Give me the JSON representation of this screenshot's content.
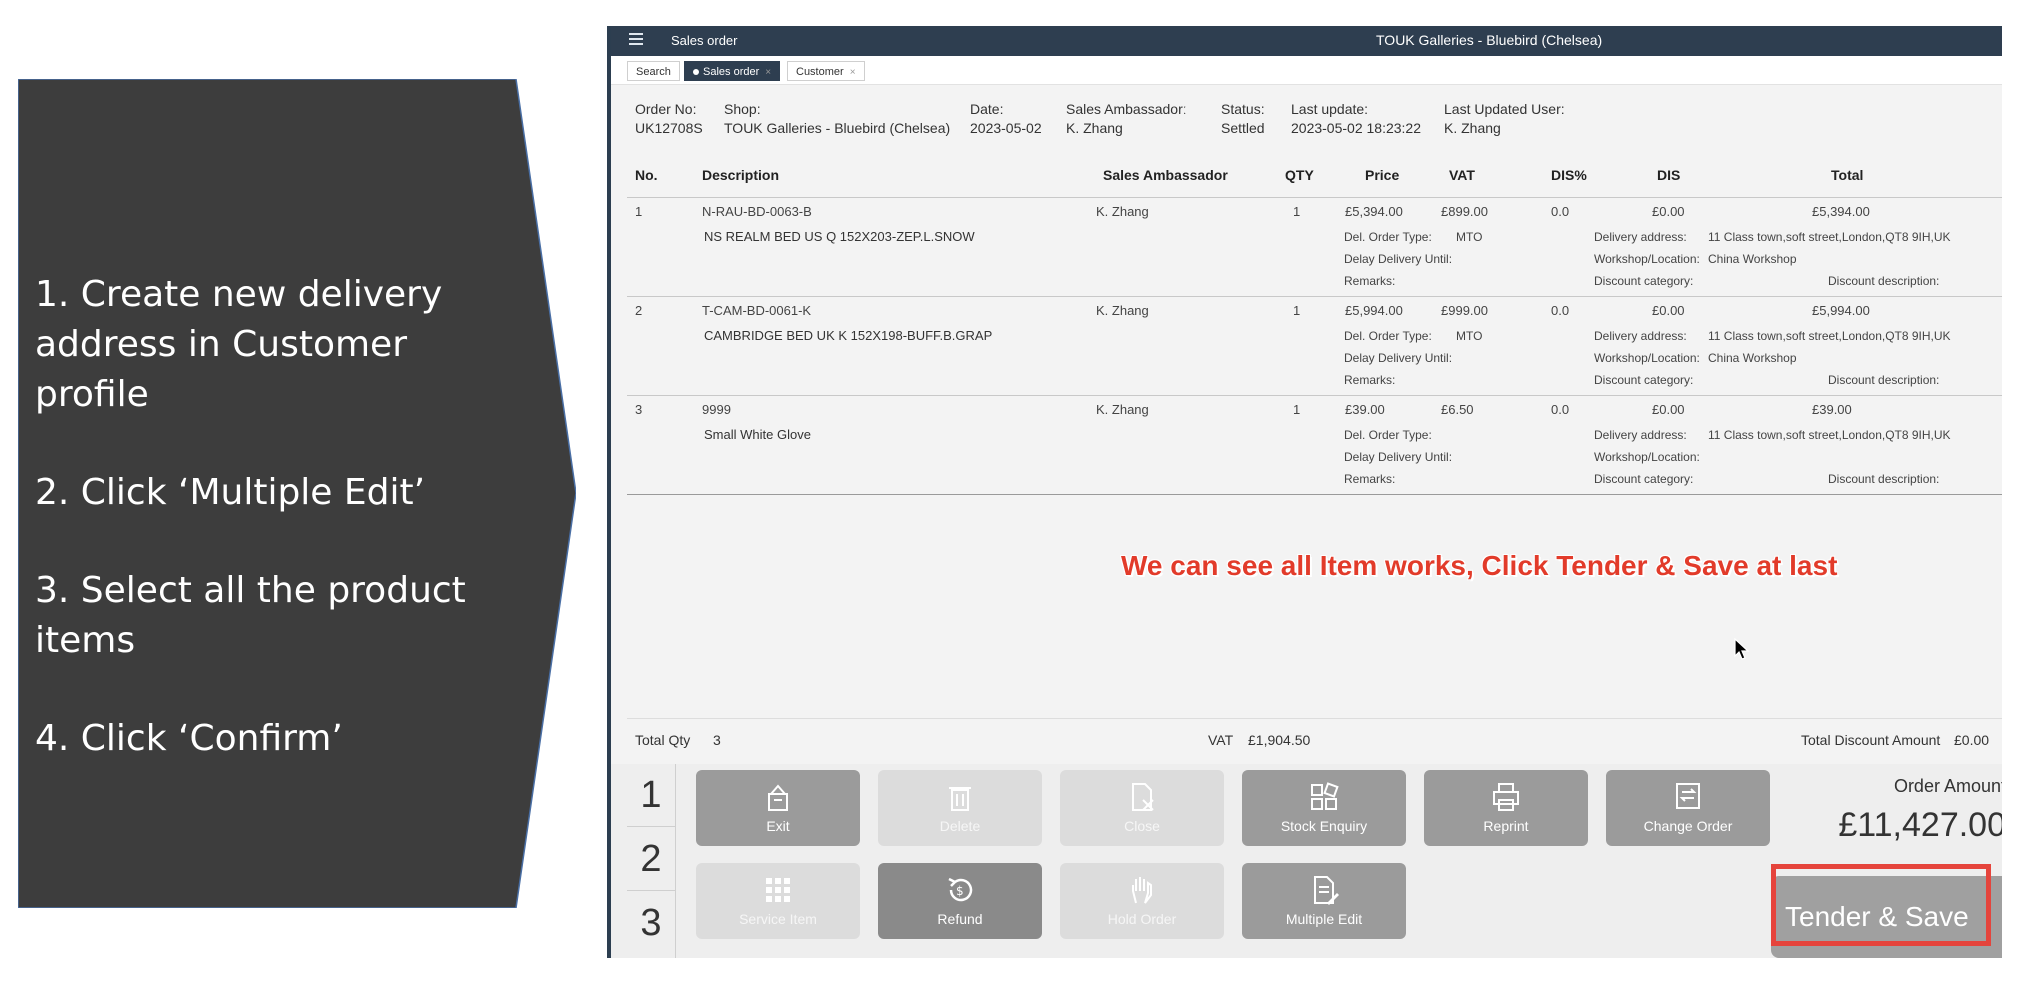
{
  "instructions": [
    "1. Create new delivery address in Customer profile",
    "2. Click ‘Multiple Edit’",
    "3. Select all the product items",
    "4. Click ‘Confirm’"
  ],
  "window": {
    "title": "Sales order",
    "shop_title": "TOUK Galleries - Bluebird (Chelsea)"
  },
  "tabs": [
    "Search",
    "Sales order",
    "Customer"
  ],
  "order_header": {
    "order_no_label": "Order No:",
    "order_no": "UK12708S",
    "shop_label": "Shop:",
    "shop": "TOUK Galleries - Bluebird (Chelsea)",
    "date_label": "Date:",
    "date": "2023-05-02",
    "ambassador_label": "Sales Ambassadorː",
    "ambassador": "K. Zhang",
    "status_label": "Status:",
    "status": "Settled",
    "last_update_label": "Last update:",
    "last_update": "2023-05-02 18:23:22",
    "last_user_label": "Last Updated User:",
    "last_user": "K. Zhang"
  },
  "columns": [
    "No.",
    "Description",
    "Sales Ambassador",
    "QTY",
    "Price",
    "VAT",
    "DIS%",
    "DIS",
    "Total"
  ],
  "detail_labels": {
    "del_type": "Del. Order Type:",
    "delay": "Delay Delivery Until:",
    "remarks": "Remarks:",
    "address": "Delivery address:",
    "workshop": "Workshop/Location:",
    "disc_cat": "Discount category:",
    "disc_desc": "Discount description:"
  },
  "items": [
    {
      "no": "1",
      "code": "N-RAU-BD-0063-B",
      "name": "NS REALM BED US Q 152X203-ZEP.L.SNOW",
      "ambassador": "K. Zhang",
      "qty": "1",
      "price": "£5,394.00",
      "vat": "£899.00",
      "dis_pct": "0.0",
      "dis": "£0.00",
      "total": "£5,394.00",
      "del_type": "MTO",
      "address": "11 Class town,soft street,London,QT8 9IH,UK",
      "workshop": "China Workshop"
    },
    {
      "no": "2",
      "code": "T-CAM-BD-0061-K",
      "name": "CAMBRIDGE BED UK K 152X198-BUFF.B.GRAP",
      "ambassador": "K. Zhang",
      "qty": "1",
      "price": "£5,994.00",
      "vat": "£999.00",
      "dis_pct": "0.0",
      "dis": "£0.00",
      "total": "£5,994.00",
      "del_type": "MTO",
      "address": "11 Class town,soft street,London,QT8 9IH,UK",
      "workshop": "China Workshop"
    },
    {
      "no": "3",
      "code": "9999",
      "name": "Small White Glove",
      "ambassador": "K. Zhang",
      "qty": "1",
      "price": "£39.00",
      "vat": "£6.50",
      "dis_pct": "0.0",
      "dis": "£0.00",
      "total": "£39.00",
      "del_type": "",
      "address": "11 Class town,soft street,London,QT8 9IH,UK",
      "workshop": ""
    }
  ],
  "annotation": "We can see all Item works, Click Tender & Save at last",
  "totals": {
    "qty_label": "Total Qty",
    "qty": "3",
    "vat_label": "VAT",
    "vat": "£1,904.50",
    "discount_label": "Total Discount Amount",
    "discount": "£0.00"
  },
  "row_numbers": [
    "1",
    "2",
    "3"
  ],
  "buttons_row1": [
    {
      "label": "Exit",
      "icon": "exit-icon",
      "enabled": true
    },
    {
      "label": "Delete",
      "icon": "trash-icon",
      "enabled": false
    },
    {
      "label": "Close",
      "icon": "close-doc-icon",
      "enabled": false
    },
    {
      "label": "Stock Enquiry",
      "icon": "stock-enquiry-icon",
      "enabled": true
    },
    {
      "label": "Reprint",
      "icon": "printer-icon",
      "enabled": true
    },
    {
      "label": "Change Order",
      "icon": "change-order-icon",
      "enabled": true
    }
  ],
  "buttons_row2": [
    {
      "label": "Service Item",
      "icon": "grid-icon",
      "enabled": false
    },
    {
      "label": "Refund",
      "icon": "refund-icon",
      "enabled": true
    },
    {
      "label": "Hold Order",
      "icon": "hand-icon",
      "enabled": false
    },
    {
      "label": "Multiple Edit",
      "icon": "edit-doc-icon",
      "enabled": true
    }
  ],
  "order_amount": {
    "label": "Order Amount",
    "value": "£11,427.00"
  },
  "tender_button": "Tender & Save",
  "colors": {
    "panel": "#3d3d3d",
    "titlebar": "#2e3e50",
    "annotation": "#e23b2a",
    "highlight": "#e5443c"
  }
}
